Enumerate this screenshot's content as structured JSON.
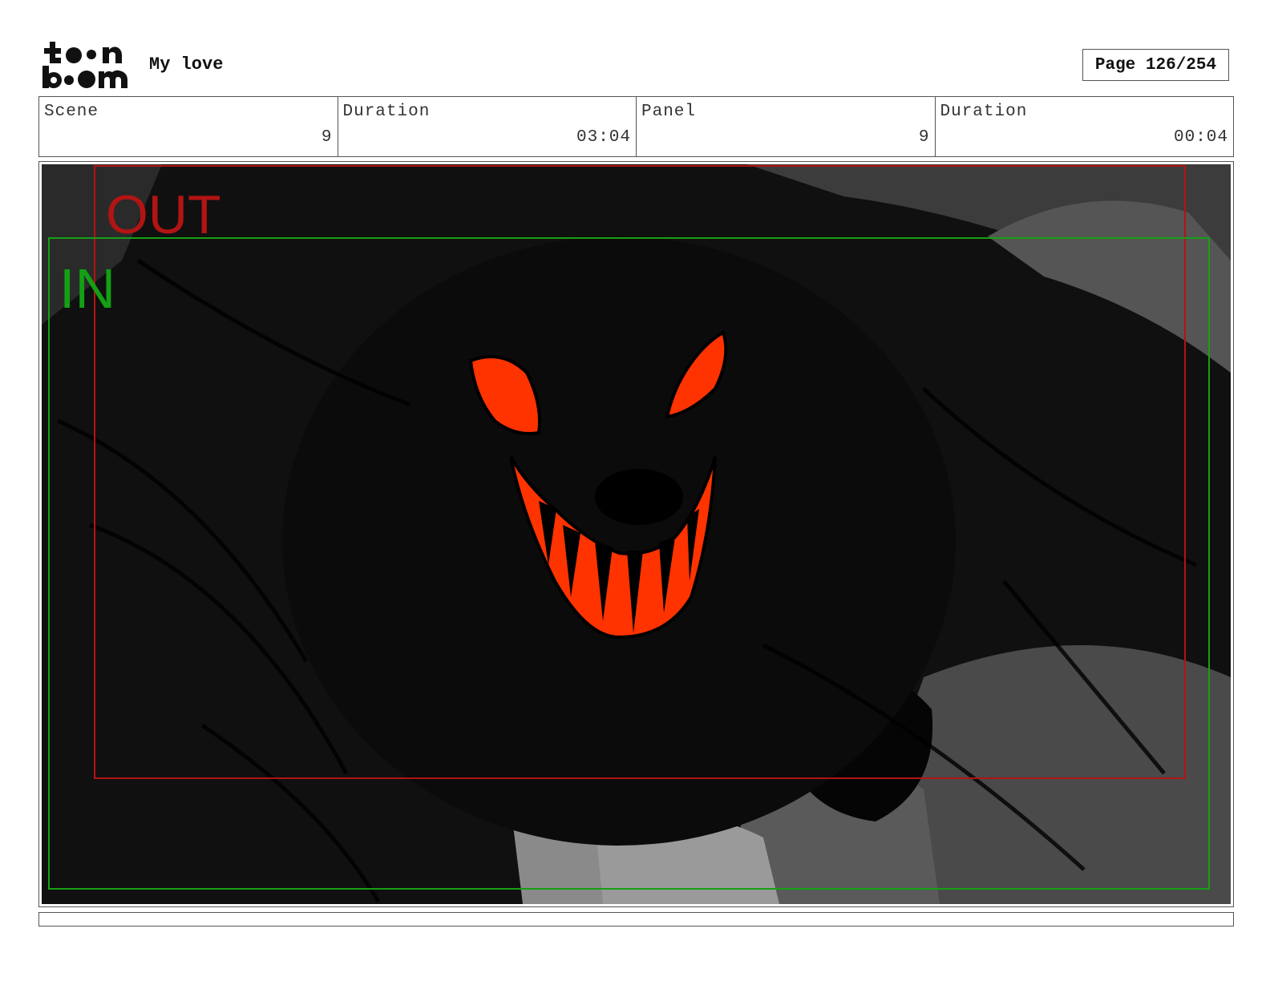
{
  "header": {
    "logo_name": "toon-boom-logo",
    "project_title": "My love",
    "page_label": "Page 126/254"
  },
  "info": {
    "scene_label": "Scene",
    "scene_value": "9",
    "scene_duration_label": "Duration",
    "scene_duration_value": "03:04",
    "panel_label": "Panel",
    "panel_value": "9",
    "panel_duration_label": "Duration",
    "panel_duration_value": "00:04"
  },
  "panel": {
    "out_label": "OUT",
    "in_label": "IN",
    "colors": {
      "out_frame": "#b21414",
      "in_frame": "#14a014",
      "accent": "#ff3300",
      "background": "#0f0f0f"
    }
  },
  "caption": {
    "text": ""
  }
}
